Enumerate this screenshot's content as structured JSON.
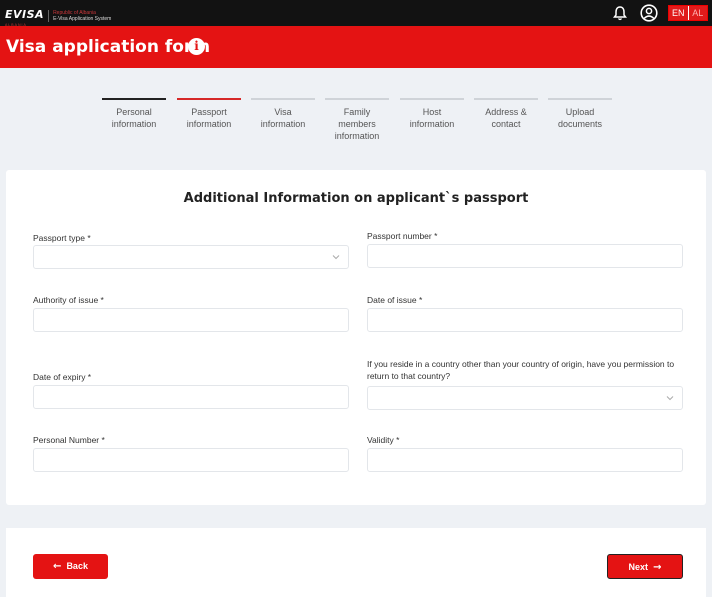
{
  "header": {
    "logo_mark": "EVISA",
    "logo_sub": "ALBANIA",
    "logo_line1": "Republic of Albania",
    "logo_line2": "E-Visa Application System",
    "lang_en": "EN",
    "lang_al": "AL"
  },
  "page": {
    "title": "Visa application form",
    "info_glyph": "i"
  },
  "steps": [
    {
      "label": "Personal information",
      "state": "done"
    },
    {
      "label": "Passport information",
      "state": "active"
    },
    {
      "label": "Visa information",
      "state": "todo"
    },
    {
      "label": "Family members information",
      "state": "todo"
    },
    {
      "label": "Host information",
      "state": "todo"
    },
    {
      "label": "Address & contact",
      "state": "todo"
    },
    {
      "label": "Upload documents",
      "state": "todo"
    }
  ],
  "form": {
    "section_title": "Additional Information on applicant`s passport",
    "passport_type_label": "Passport type *",
    "passport_number_label": "Passport number *",
    "authority_label": "Authority of issue *",
    "date_issue_label": "Date of issue *",
    "date_expiry_label": "Date of expiry *",
    "return_permission_label": "If you reside in a country other than your country of origin, have you permission to return to that country?",
    "personal_number_label": "Personal Number *",
    "validity_label": "Validity *",
    "passport_type_value": "",
    "passport_number_value": "",
    "authority_value": "",
    "date_issue_value": "",
    "date_expiry_value": "",
    "return_permission_value": "",
    "personal_number_value": "",
    "validity_value": ""
  },
  "nav": {
    "back_label": "Back",
    "next_label": "Next",
    "back_arrow": "←",
    "next_arrow": "→"
  },
  "colors": {
    "brand_red": "#e41313",
    "topbar": "#121212",
    "step_done": "#222222",
    "step_active": "#d62828"
  }
}
